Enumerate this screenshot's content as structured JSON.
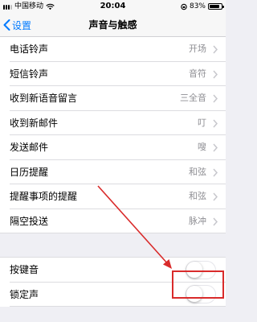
{
  "status_bar": {
    "carrier": "中国移动",
    "time": "20:04",
    "battery_percent": "83%",
    "battery_level": 0.83
  },
  "nav": {
    "back_label": "设置",
    "title": "声音与触感"
  },
  "settings": [
    {
      "label": "电话铃声",
      "value": "开场"
    },
    {
      "label": "短信铃声",
      "value": "音符"
    },
    {
      "label": "收到新语音留言",
      "value": "三全音"
    },
    {
      "label": "收到新邮件",
      "value": "叮"
    },
    {
      "label": "发送邮件",
      "value": "嗖"
    },
    {
      "label": "日历提醒",
      "value": "和弦"
    },
    {
      "label": "提醒事项的提醒",
      "value": "和弦"
    },
    {
      "label": "隔空投送",
      "value": "脉冲"
    }
  ],
  "toggles": [
    {
      "label": "按键音",
      "on": false
    },
    {
      "label": "锁定声",
      "on": false
    }
  ],
  "colors": {
    "accent": "#007aff",
    "annotation": "#d92b2b"
  }
}
